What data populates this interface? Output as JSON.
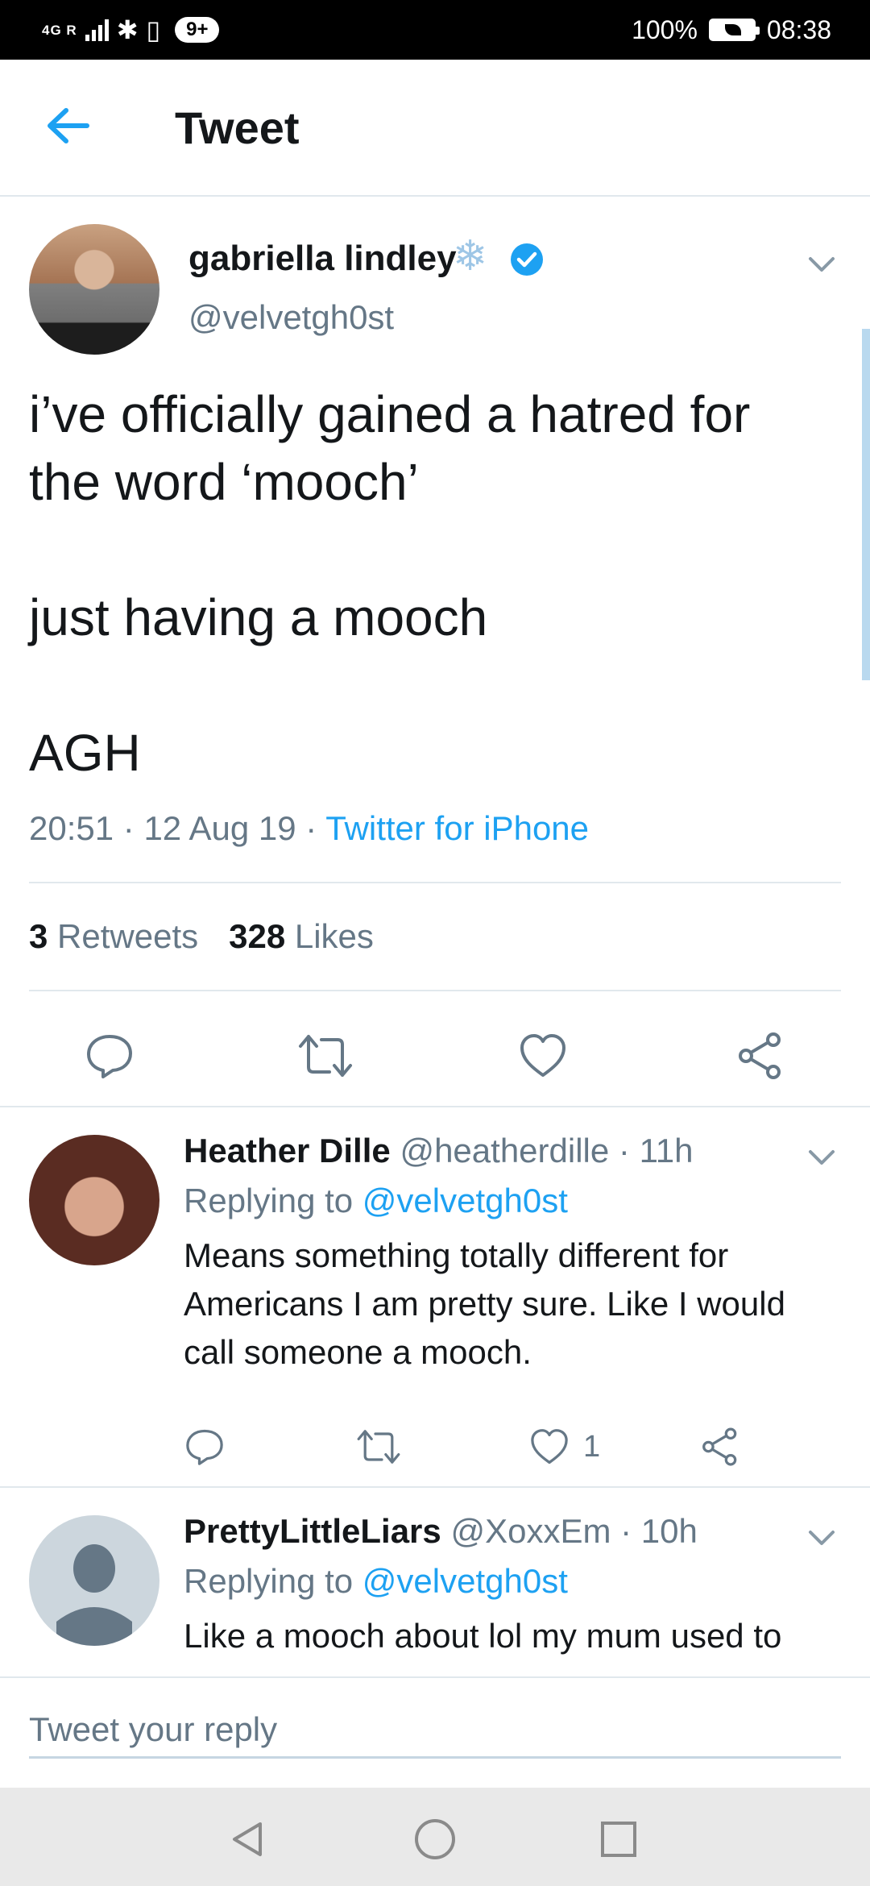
{
  "status_bar": {
    "network": "4G R",
    "notification_count": "9+",
    "battery_percent": "100%",
    "time": "08:38"
  },
  "header": {
    "title": "Tweet"
  },
  "main_tweet": {
    "display_name": "gabriella lindley",
    "handle": "@velvetgh0st",
    "text": "i’ve officially gained a hatred for\nthe word ‘mooch’\n\njust having a mooch\n\nAGH",
    "time": "20:51",
    "date": "12 Aug 19",
    "source": "Twitter for iPhone",
    "retweets_count": "3",
    "retweets_label": "Retweets",
    "likes_count": "328",
    "likes_label": "Likes"
  },
  "replies": [
    {
      "display_name": "Heather Dille",
      "handle": "@heatherdille",
      "age": "11h",
      "replying_label": "Replying to",
      "replying_to": "@velvetgh0st",
      "text": "Means something totally different for Americans I am pretty sure. Like I would call someone a mooch.",
      "likes": "1"
    },
    {
      "display_name": "PrettyLittleLiars",
      "handle": "@XoxxEm",
      "age": "10h",
      "replying_label": "Replying to",
      "replying_to": "@velvetgh0st",
      "text": "Like a mooch about lol my mum used to"
    }
  ],
  "compose": {
    "placeholder": "Tweet your reply"
  },
  "colors": {
    "accent": "#1da1f2",
    "secondary_text": "#657786",
    "divider": "#e1e8ed"
  }
}
